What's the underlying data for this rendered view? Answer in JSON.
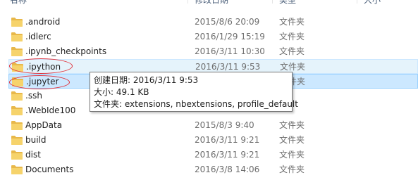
{
  "header": {
    "name_col": "名称",
    "date_col": "修改日期",
    "type_col": "类型",
    "size_col": "大小"
  },
  "files": [
    {
      "name": ".android",
      "date": "2015/8/6 20:09",
      "type": "文件夹"
    },
    {
      "name": ".idlerc",
      "date": "2016/1/29 15:19",
      "type": "文件夹"
    },
    {
      "name": ".ipynb_checkpoints",
      "date": "2016/3/11 10:30",
      "type": "文件夹"
    },
    {
      "name": ".ipython",
      "date": "2016/3/11 9:53",
      "type": "文件夹"
    },
    {
      "name": ".jupyter",
      "date": "",
      "type": "文件夹"
    },
    {
      "name": ".ssh",
      "date": "",
      "type": ""
    },
    {
      "name": ".WebIde100",
      "date": "",
      "type": ""
    },
    {
      "name": "AppData",
      "date": "2015/8/3 9:40",
      "type": "文件夹"
    },
    {
      "name": "build",
      "date": "2016/3/11 9:21",
      "type": "文件夹"
    },
    {
      "name": "dist",
      "date": "2016/3/11 9:21",
      "type": "文件夹"
    },
    {
      "name": "Documents",
      "date": "2016/3/8 14:06",
      "type": "文件夹"
    }
  ],
  "tooltip": {
    "created": "创建日期: 2016/3/11 9:53",
    "size": "大小: 49.1 KB",
    "contents": "文件夹: extensions, nbextensions, profile_default"
  },
  "colors": {
    "folder": "#e8b84a",
    "selection": "#cce8ff",
    "hover": "#e5f3fb",
    "annotation": "#e0303a"
  }
}
